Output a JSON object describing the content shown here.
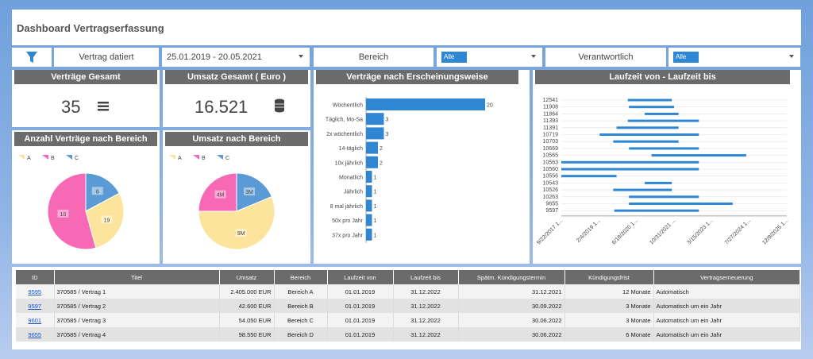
{
  "header": {
    "title": "Dashboard Vertragserfassung"
  },
  "filters": {
    "vertrag_label": "Vertrag datiert",
    "date_range": "25.01.2019 - 20.05.2021",
    "bereich_label": "Bereich",
    "bereich_value": "Alle",
    "verantwortlich_label": "Verantwortlich",
    "verantwortlich_value": "Alle"
  },
  "kpis": {
    "vertraege_title": "Verträge Gesamt",
    "vertraege_value": "35",
    "umsatz_title": "Umsatz Gesamt ( Euro )",
    "umsatz_value": "16.521"
  },
  "pie1": {
    "title": "Anzahl Verträge nach Bereich",
    "legend": [
      "A",
      "B",
      "C"
    ],
    "labels": [
      "19",
      "10",
      "6"
    ]
  },
  "pie2": {
    "title": "Umsatz nach Bereich",
    "legend": [
      "A",
      "B",
      "C"
    ],
    "labels": [
      "9M",
      "4M",
      "3M"
    ]
  },
  "colors": {
    "A": "#fde49c",
    "B": "#f769b4",
    "C": "#5b9bd5",
    "bar": "#2f86d2"
  },
  "chart_data": [
    {
      "type": "pie",
      "title": "Anzahl Verträge nach Bereich",
      "categories": [
        "A",
        "B",
        "C"
      ],
      "values": [
        10,
        19,
        6
      ]
    },
    {
      "type": "pie",
      "title": "Umsatz nach Bereich",
      "categories": [
        "A",
        "B",
        "C"
      ],
      "values": [
        9,
        4,
        3
      ]
    },
    {
      "type": "bar",
      "title": "Verträge nach Erscheinungsweise",
      "categories": [
        "Wöchentlich",
        "Täglich, Mo-Sa",
        "2x wöchentlich",
        "14-täglich",
        "10x jährlich",
        "Monatlich",
        "Jährlich",
        "8 mal jährlich",
        "50x pro Jahr",
        "37x pro Jahr"
      ],
      "values": [
        20,
        3,
        3,
        2,
        2,
        1,
        1,
        1,
        1,
        1
      ]
    },
    {
      "type": "bar",
      "title": "Laufzeit von - Laufzeit bis",
      "categories": [
        "12541",
        "11908",
        "11864",
        "11393",
        "11391",
        "10719",
        "10703",
        "10669",
        "10565",
        "10563",
        "10560",
        "10556",
        "10543",
        "10526",
        "10263",
        "9655",
        "9597"
      ],
      "x_ticks": [
        "9/22/2017 1...",
        "2/4/2019 1...",
        "6/18/2020 1...",
        "10/31/2021 ...",
        "3/15/2023 1...",
        "7/27/2024 1...",
        "12/9/2025 1..."
      ]
    }
  ],
  "table": {
    "headers": [
      "ID",
      "Titel",
      "Umsatz",
      "Bereich",
      "Laufzeit von",
      "Laufzeit bis",
      "Spätm. Kündigungstermin",
      "Kündigungsfrist",
      "Vertragserneuerung"
    ],
    "rows": [
      [
        "9595",
        "370585 / Vertrag 1",
        "2.405.000 EUR",
        "Bereich A",
        "01.01.2019",
        "31.12.2022",
        "31.12.2021",
        "12 Monate",
        "Automatisch"
      ],
      [
        "9597",
        "370585 / Vertrag 2",
        "42.600 EUR",
        "Bereich B",
        "01.01.2019",
        "31.12.2022",
        "30.09.2022",
        "3 Monate",
        "Automatisch um ein Jahr"
      ],
      [
        "9601",
        "370585 / Vertrag 3",
        "54.050 EUR",
        "Bereich C",
        "01.01.2019",
        "31.12.2022",
        "30.06.2022",
        "3 Monate",
        "Automatisch um ein Jahr"
      ],
      [
        "9655",
        "370585 / Vertrag 4",
        "98.550 EUR",
        "Bereich D",
        "01.01.2019",
        "31.12.2022",
        "30.06.2022",
        "6 Monate",
        "Automatisch um ein Jahr"
      ]
    ]
  }
}
